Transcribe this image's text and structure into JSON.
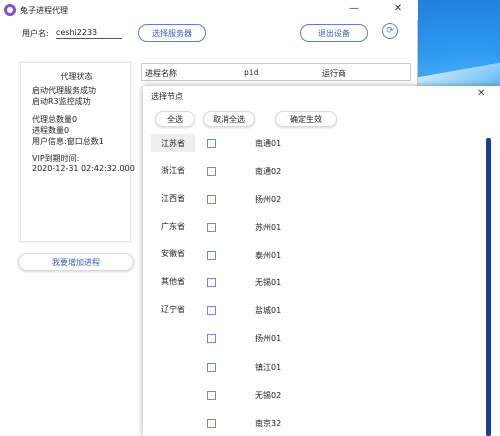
{
  "window": {
    "title": "兔子进程代理"
  },
  "toolbar": {
    "user_label": "用户名:",
    "username": "ceshi2233",
    "select_server": "选择服务器",
    "logout": "退出设备"
  },
  "status_panel": {
    "title": "代理状态",
    "lines": [
      "启动代理服务成功",
      "启动R3监控成功",
      "代理总数量0",
      "进程数量0",
      "用户信息:窗口总数1",
      "VIP到期时间:",
      "2020-12-31 02:42:32.000"
    ]
  },
  "add_process_button": "我要增加进程",
  "process_table": {
    "columns": [
      "进程名称",
      "pid",
      "运行商"
    ]
  },
  "dialog": {
    "title": "选择节点",
    "select_all": "全选",
    "deselect_all": "取消全选",
    "confirm": "确定生效",
    "provinces": [
      "江苏省",
      "浙江省",
      "江西省",
      "广东省",
      "安徽省",
      "其他省",
      "辽宁省"
    ],
    "selected_province": "江苏省",
    "nodes": [
      "南通01",
      "南通02",
      "扬州02",
      "苏州01",
      "泰州01",
      "无锡01",
      "盐城01",
      "扬州01",
      "镇江01",
      "无锡02",
      "南京32"
    ]
  },
  "colors": {
    "accent": "#3a5fb8",
    "scrollbar": "#1e3f8f",
    "app_icon": "#8b4cc7"
  }
}
